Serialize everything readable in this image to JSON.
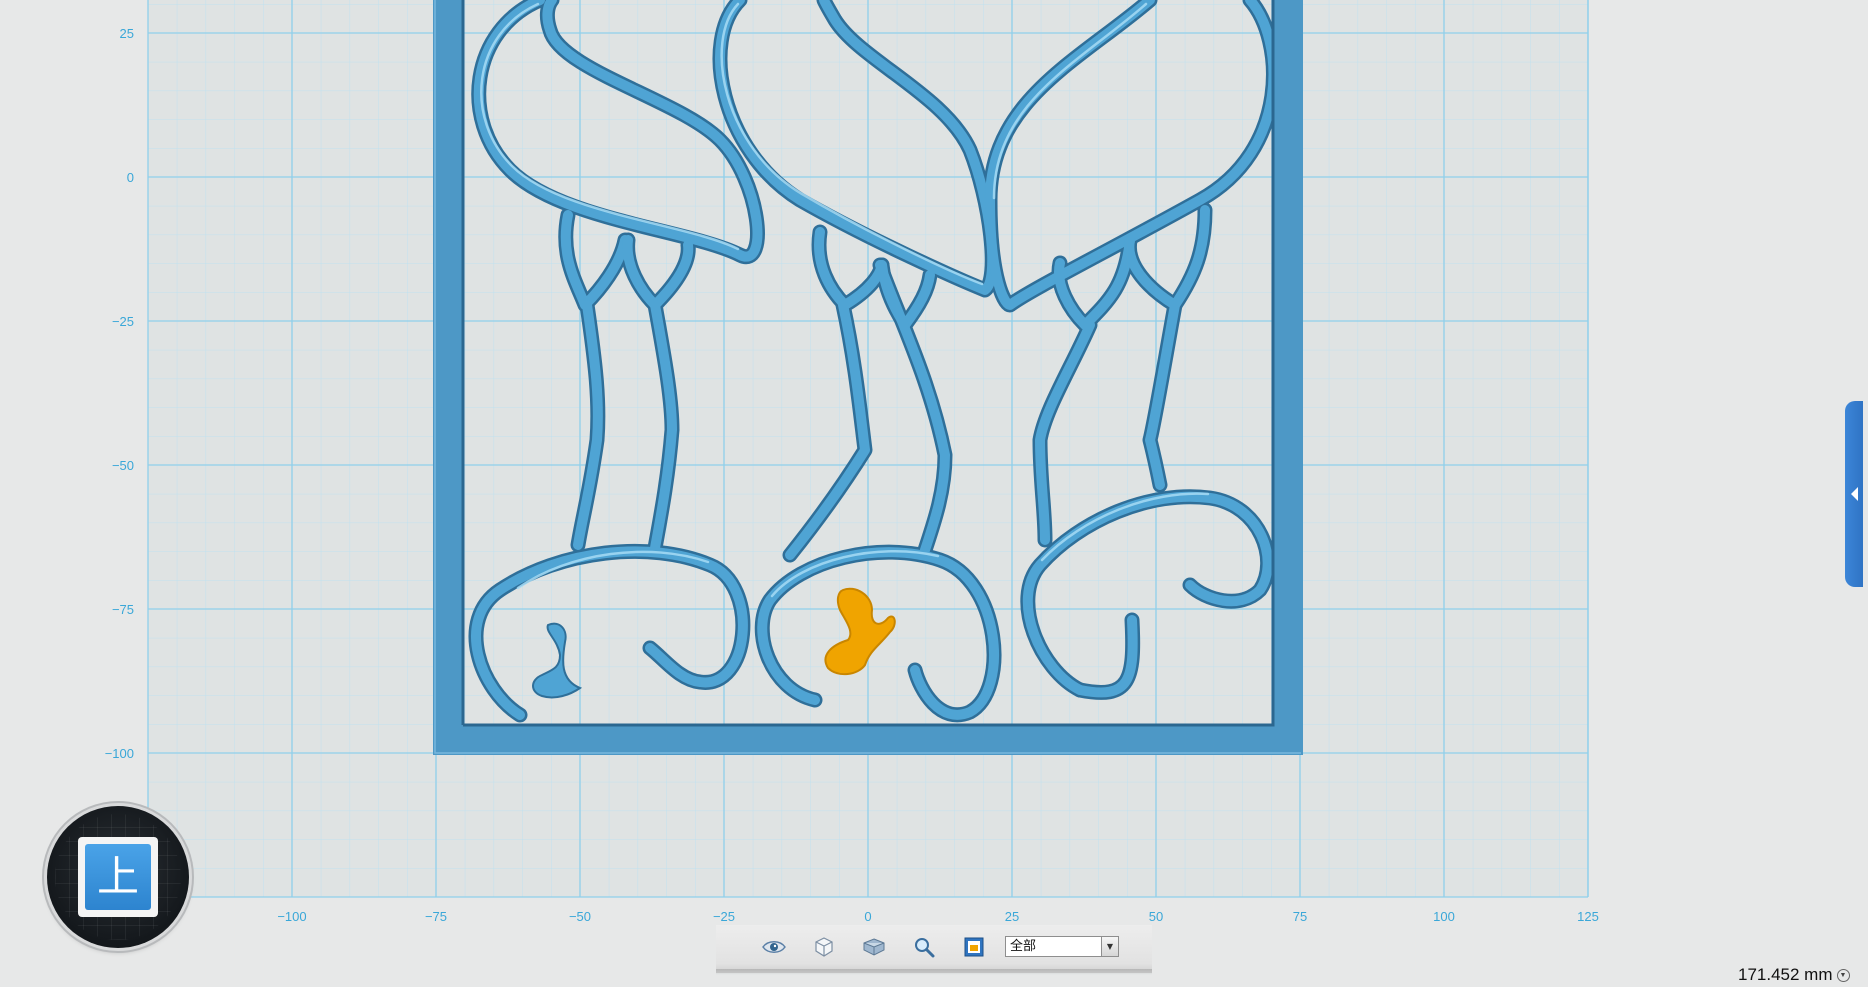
{
  "viewport": {
    "x_axis_labels": [
      "−100",
      "−75",
      "−50",
      "−25",
      "0",
      "25",
      "50",
      "75",
      "100",
      "125"
    ],
    "y_axis_labels": [
      "25",
      "0",
      "−25",
      "−50",
      "−75",
      "−100"
    ],
    "grid_color": "#8fd0ec",
    "model_color": "#4a98c8",
    "highlight_color": "#f0a400"
  },
  "view_cube": {
    "face_label": "上",
    "face_color": "#3b92dc"
  },
  "toolbar": {
    "buttons": [
      "eye-icon",
      "cube-icon",
      "cube-solid-icon",
      "zoom-icon",
      "fit-view-icon"
    ],
    "view_select": {
      "value": "全部"
    }
  },
  "status": {
    "measurement": "171.452 mm"
  },
  "side_panel": {
    "toggle_icon": "chevron-left-icon"
  }
}
